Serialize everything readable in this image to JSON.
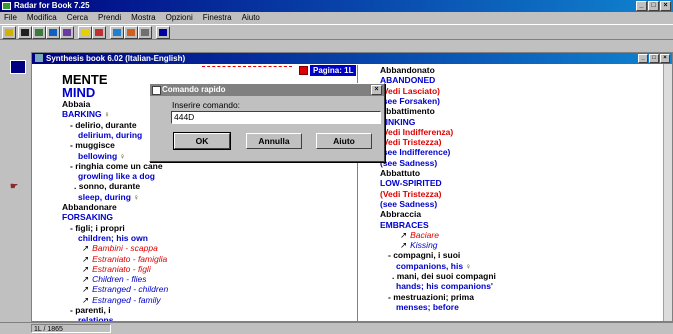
{
  "app": {
    "title": "Radar for Book 7.25"
  },
  "menu": [
    "File",
    "Modifica",
    "Cerca",
    "Prendi",
    "Mostra",
    "Opzioni",
    "Finestra",
    "Aiuto"
  ],
  "doc": {
    "title": "Synthesis book 6.02 (Italian-English)",
    "page_label": "Pagina: 1L"
  },
  "left_column": [
    {
      "text": "MENTE",
      "style": "blk big"
    },
    {
      "text": "MIND",
      "style": "blu big"
    },
    {
      "text": "Abbaia",
      "style": "blk"
    },
    {
      "text": "BARKING",
      "style": "blu",
      "bulb": true
    },
    {
      "text": "- delirio, durante",
      "style": "blk"
    },
    {
      "text": "delirium, during",
      "style": "blu"
    },
    {
      "text": "- muggisce",
      "style": "blk"
    },
    {
      "text": "bellowing",
      "style": "blu",
      "bulb": true
    },
    {
      "text": "- ringhia come un cane",
      "style": "blk"
    },
    {
      "text": "growling like a dog",
      "style": "blu"
    },
    {
      "text": ". sonno, durante",
      "style": "blk"
    },
    {
      "text": "sleep, during",
      "style": "blu",
      "bulb": true
    },
    {
      "text": "Abbandonare",
      "style": "blk"
    },
    {
      "text": "FORSAKING",
      "style": "blu"
    },
    {
      "text": "- figli; i propri",
      "style": "blk"
    },
    {
      "text": "children; his own",
      "style": "blu"
    },
    {
      "text": "Bambini - scappa",
      "style": "redit",
      "arrow": true
    },
    {
      "text": "Estraniato - famiglia",
      "style": "redit",
      "arrow": true
    },
    {
      "text": "Estraniato - figli",
      "style": "redit",
      "arrow": true
    },
    {
      "text": "Children - flies",
      "style": "bluit",
      "arrow": true
    },
    {
      "text": "Estranged - children",
      "style": "bluit",
      "arrow": true
    },
    {
      "text": "Estranged - family",
      "style": "bluit",
      "arrow": true
    },
    {
      "text": "- parenti, i",
      "style": "blk"
    },
    {
      "text": "relations",
      "style": "blu"
    }
  ],
  "right_column": [
    {
      "text": "Abbandonato",
      "style": "blk"
    },
    {
      "text": "ABANDONED",
      "style": "blu"
    },
    {
      "text": "(Vedi Lasciato)",
      "style": "red"
    },
    {
      "text": "(see Forsaken)",
      "style": "blu"
    },
    {
      "text": "Abbattimento",
      "style": "blk"
    },
    {
      "text": "SINKING",
      "style": "blu"
    },
    {
      "text": "(Vedi Indifferenza)",
      "style": "red"
    },
    {
      "text": "(Vedi Tristezza)",
      "style": "red"
    },
    {
      "text": "(see Indifference)",
      "style": "blu"
    },
    {
      "text": "(see Sadness)",
      "style": "blu"
    },
    {
      "text": "Abbattuto",
      "style": "blk"
    },
    {
      "text": "LOW-SPIRITED",
      "style": "blu"
    },
    {
      "text": "(Vedi Tristezza)",
      "style": "red"
    },
    {
      "text": "(see Sadness)",
      "style": "blu"
    },
    {
      "text": "Abbraccia",
      "style": "blk"
    },
    {
      "text": "EMBRACES",
      "style": "blu"
    },
    {
      "text": "Baciare",
      "style": "redit",
      "arrow": true
    },
    {
      "text": "Kissing",
      "style": "bluit",
      "arrow": true
    },
    {
      "text": "- compagni, i suoi",
      "style": "blk"
    },
    {
      "text": "companions, his",
      "style": "blu",
      "bulb": true
    },
    {
      "text": ". mani, dei suoi compagni",
      "style": "blk"
    },
    {
      "text": "hands; his companions'",
      "style": "blu"
    },
    {
      "text": "- mestruazioni; prima",
      "style": "blk"
    },
    {
      "text": "menses; before",
      "style": "blu"
    }
  ],
  "dialog": {
    "title": "Comando rapido",
    "prompt": "Inserire comando:",
    "value": "444D",
    "ok": "OK",
    "cancel": "Annulla",
    "help": "Aiuto"
  },
  "status": {
    "text": "1L / 1865"
  },
  "colors": {
    "title_active": "#000080",
    "entry_blue": "#0000cc",
    "entry_red": "#e00000"
  }
}
